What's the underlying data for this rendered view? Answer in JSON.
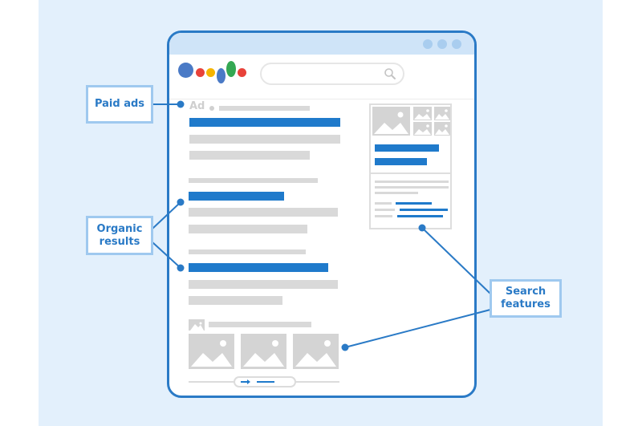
{
  "diagram": {
    "type": "annotated-serp-mockup",
    "callouts": [
      {
        "id": "paid-ads",
        "label": "Paid ads"
      },
      {
        "id": "organic-results",
        "label": "Organic\nresults",
        "lines": [
          "Organic",
          "results"
        ]
      },
      {
        "id": "search-features",
        "label": "Search\nfeatures",
        "lines": [
          "Search",
          "features"
        ]
      }
    ],
    "serp": {
      "ad_label": "Ad",
      "logo_colors": [
        "#4a7ac6",
        "#e8423a",
        "#f5b400",
        "#4a7ac6",
        "#34a853",
        "#e8423a"
      ],
      "window_dots": 3,
      "search_icon": "magnifier-icon",
      "carousel_icon": "arrow-right-icon"
    },
    "colors": {
      "accent": "#2a7ac6",
      "link_bar": "#1f7acb",
      "placeholder_bar": "#d9d9d9",
      "panel_background": "#e3f0fc",
      "titlebar": "#cfe4f8",
      "callout_border": "#9fc9ef"
    }
  }
}
